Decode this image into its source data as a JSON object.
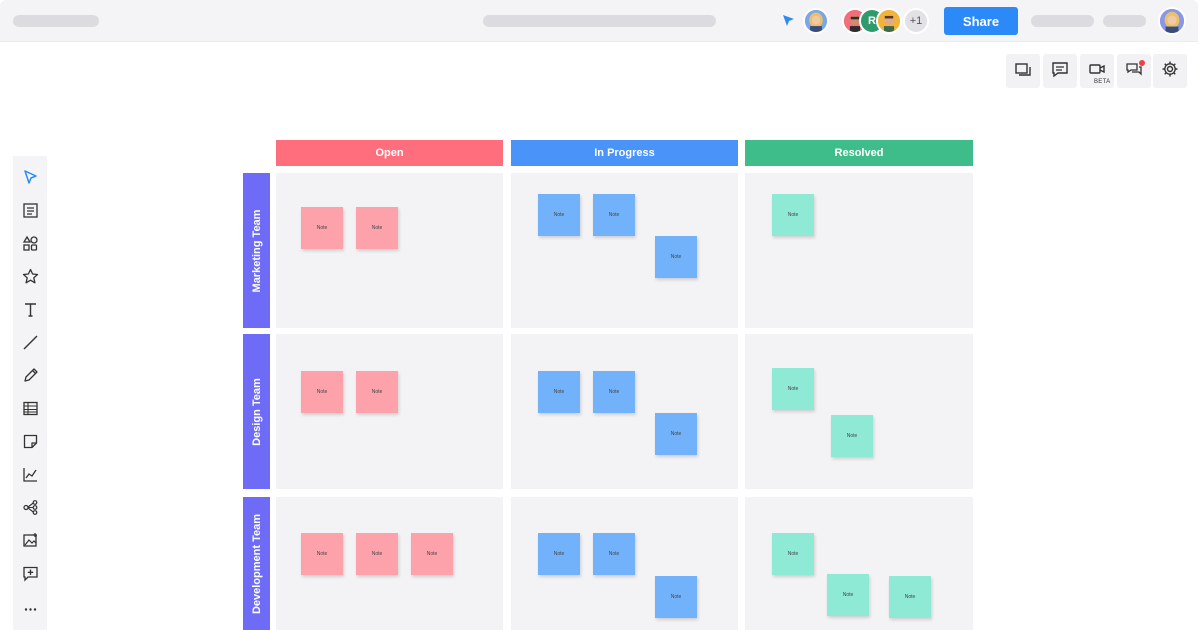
{
  "topbar": {
    "share_label": "Share",
    "collaborator_initial": "R",
    "extra_collaborators": "+1"
  },
  "right_tools": {
    "video_badge": "BETA"
  },
  "board": {
    "columns": [
      {
        "label": "Open",
        "color": "#fe6e7c"
      },
      {
        "label": "In Progress",
        "color": "#4a93f8"
      },
      {
        "label": "Resolved",
        "color": "#3ebd8b"
      }
    ],
    "rows": [
      {
        "label": "Marketing Team"
      },
      {
        "label": "Design Team"
      },
      {
        "label": "Development Team"
      }
    ],
    "note_label": "Note",
    "note_colors": {
      "open": "#fda2ab",
      "in_progress": "#72b2fb",
      "resolved": "#8ee9d5"
    }
  },
  "colors": {
    "accent": "#2b8af7",
    "row_header": "#6e6cf6",
    "cursor": "#2b8af7"
  }
}
